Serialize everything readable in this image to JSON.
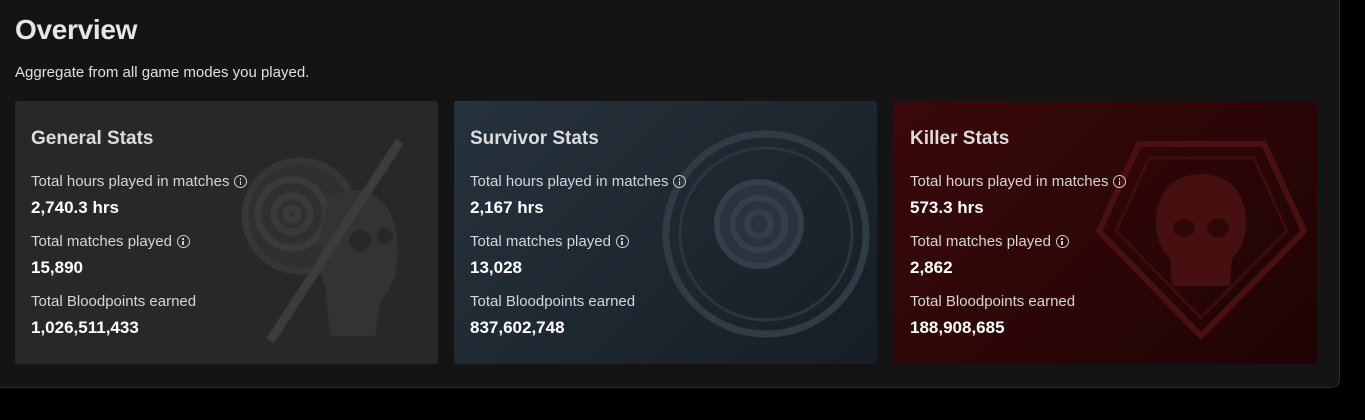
{
  "overview": {
    "title": "Overview",
    "subtitle": "Aggregate from all game modes you played."
  },
  "cards": [
    {
      "title": "General Stats",
      "hours_label": "Total hours played in matches",
      "hours_value": "2,740.3 hrs",
      "matches_label": "Total matches played",
      "matches_value": "15,890",
      "bloodpoints_label": "Total Bloodpoints earned",
      "bloodpoints_value": "1,026,511,433"
    },
    {
      "title": "Survivor Stats",
      "hours_label": "Total hours played in matches",
      "hours_value": "2,167 hrs",
      "matches_label": "Total matches played",
      "matches_value": "13,028",
      "bloodpoints_label": "Total Bloodpoints earned",
      "bloodpoints_value": "837,602,748"
    },
    {
      "title": "Killer Stats",
      "hours_label": "Total hours played in matches",
      "hours_value": "573.3 hrs",
      "matches_label": "Total matches played",
      "matches_value": "2,862",
      "bloodpoints_label": "Total Bloodpoints earned",
      "bloodpoints_value": "188,908,685"
    }
  ],
  "icons": {
    "info": "info-icon",
    "general_emblem": "general-emblem-icon",
    "survivor_emblem": "survivor-emblem-icon",
    "killer_emblem": "killer-emblem-icon"
  },
  "colors": {
    "page_background": "#000000",
    "panel_background": "#141414",
    "general_card": "#282828",
    "survivor_card": "#1d2730",
    "killer_card": "#2a0606"
  }
}
